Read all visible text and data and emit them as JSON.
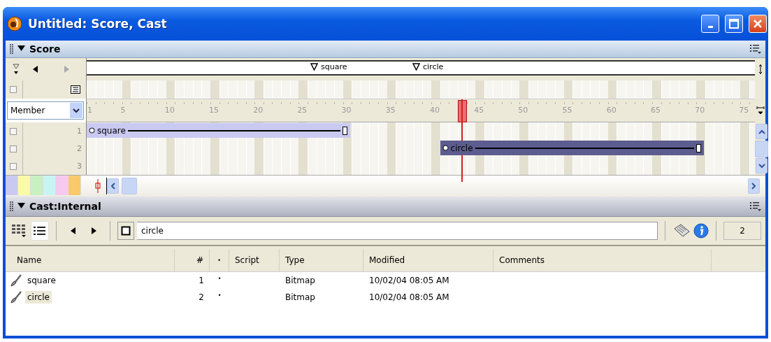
{
  "window": {
    "title": "Untitled: Score, Cast"
  },
  "score": {
    "title": "Score",
    "expanded": true,
    "marker_nav": [
      {
        "kind": "prev",
        "disabled": false
      },
      {
        "kind": "next",
        "disabled": true
      }
    ],
    "markers": [
      {
        "label": "square"
      },
      {
        "label": "circle"
      }
    ],
    "script_channel": {
      "checked": false
    },
    "display_mode": "Member",
    "ruler_labels": [
      "1",
      "5",
      "10",
      "15",
      "20",
      "25",
      "30",
      "35",
      "40",
      "45",
      "50",
      "55",
      "60",
      "65",
      "70",
      "75"
    ],
    "channels": [
      {
        "number": "1",
        "checked": false,
        "sprite": {
          "label": "square",
          "color": "#c9c9f2"
        }
      },
      {
        "number": "2",
        "checked": false,
        "sprite": {
          "label": "circle",
          "color": "#5c5c8e"
        }
      },
      {
        "number": "3",
        "checked": false
      }
    ],
    "color_swatches": [
      {
        "color": "#c9c9f2"
      },
      {
        "color": "#fbfaa6"
      },
      {
        "color": "#c8f0c0"
      },
      {
        "color": "#c9f4f4"
      },
      {
        "color": "#f6c9f0"
      },
      {
        "color": "#fcc86c"
      }
    ]
  },
  "cast": {
    "title": "Cast:Internal",
    "expanded": true,
    "view_buttons": [
      {
        "kind": "thumbnail",
        "selected": false
      },
      {
        "kind": "list",
        "selected": true
      }
    ],
    "member_name": "circle",
    "member_number": "2",
    "columns": [
      "Name",
      "#",
      "•",
      "Script",
      "Type",
      "Modified",
      "Comments"
    ],
    "rows": [
      {
        "name": "square",
        "number": "1",
        "mark": "•",
        "type": "Bitmap",
        "modified": "10/02/04 08:05 AM",
        "selected": false
      },
      {
        "name": "circle",
        "number": "2",
        "mark": "•",
        "type": "Bitmap",
        "modified": "10/02/04 08:05 AM",
        "selected": true
      }
    ]
  }
}
